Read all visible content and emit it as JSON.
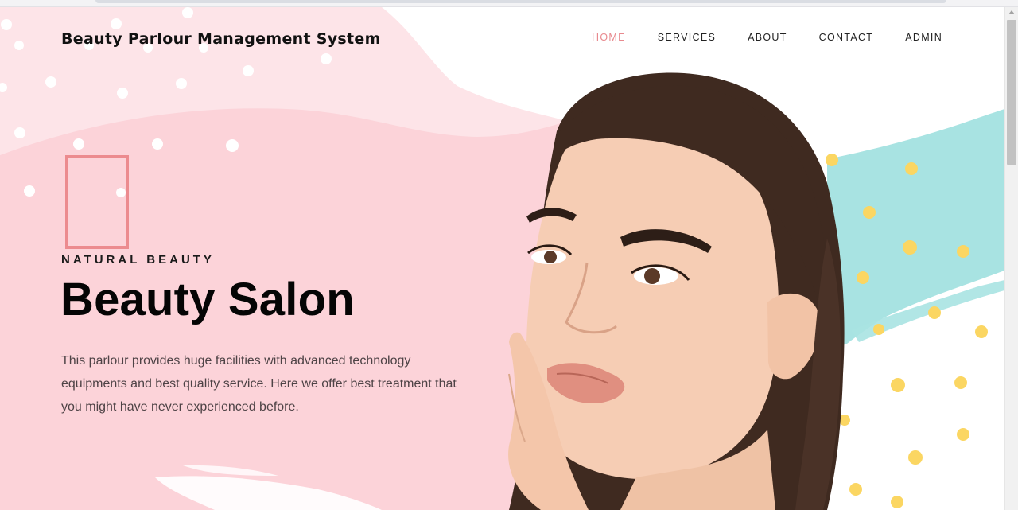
{
  "header": {
    "brand": "Beauty Parlour Management System",
    "nav": [
      {
        "label": "HOME",
        "active": true
      },
      {
        "label": "SERVICES",
        "active": false
      },
      {
        "label": "ABOUT",
        "active": false
      },
      {
        "label": "CONTACT",
        "active": false
      },
      {
        "label": "ADMIN",
        "active": false
      }
    ]
  },
  "hero": {
    "eyebrow": "NATURAL BEAUTY",
    "title": "Beauty Salon",
    "description": "This parlour provides huge facilities with advanced technology equipments and best quality service. Here we offer best treatment that you might have never experienced before.",
    "image": "woman-portrait"
  },
  "colors": {
    "accent": "#e8898e",
    "pink_bg": "#fcd3d9",
    "pink_light": "#fde4e8",
    "teal": "#a8e3e2",
    "yellow_dot": "#fbd662",
    "hair": "#3f2a20",
    "skin": "#f6cdb4"
  }
}
